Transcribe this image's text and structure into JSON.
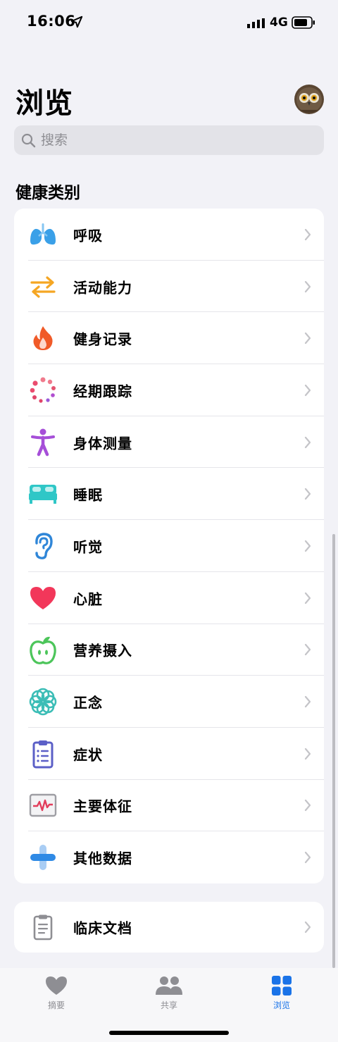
{
  "status_bar": {
    "time": "16:06",
    "network": "4G",
    "icons": [
      "location-arrow-icon",
      "signal-icon",
      "battery-icon"
    ]
  },
  "header": {
    "title": "浏览",
    "search_placeholder": "搜索"
  },
  "section": {
    "title": "健康类别"
  },
  "categories": [
    {
      "label": "呼吸",
      "icon": "lungs-icon",
      "color": "#3aa0e8"
    },
    {
      "label": "活动能力",
      "icon": "arrows-swap-icon",
      "color": "#f5a623"
    },
    {
      "label": "健身记录",
      "icon": "flame-icon",
      "color": "#f05a28"
    },
    {
      "label": "经期跟踪",
      "icon": "cycle-dots-icon",
      "color": "#ea4c6e"
    },
    {
      "label": "身体测量",
      "icon": "figure-icon",
      "color": "#a64fd8"
    },
    {
      "label": "睡眠",
      "icon": "bed-icon",
      "color": "#2fc7c7"
    },
    {
      "label": "听觉",
      "icon": "ear-icon",
      "color": "#2f86d8"
    },
    {
      "label": "心脏",
      "icon": "heart-icon",
      "color": "#f2375a"
    },
    {
      "label": "营养摄入",
      "icon": "apple-icon",
      "color": "#4cc55a"
    },
    {
      "label": "正念",
      "icon": "mindfulness-flower-icon",
      "color": "#3bbdb6"
    },
    {
      "label": "症状",
      "icon": "clipboard-icon",
      "color": "#5b5fc7"
    },
    {
      "label": "主要体征",
      "icon": "vitals-monitor-icon",
      "color": "#e23d5b"
    },
    {
      "label": "其他数据",
      "icon": "plus-cross-icon",
      "color": "#2f8ae5"
    }
  ],
  "clinical": {
    "label": "临床文档",
    "icon": "document-icon"
  },
  "tabs": [
    {
      "label": "摘要",
      "icon": "heart-tab-icon",
      "active": false
    },
    {
      "label": "共享",
      "icon": "people-icon",
      "active": false
    },
    {
      "label": "浏览",
      "icon": "grid-icon",
      "active": true
    }
  ],
  "colors": {
    "accent": "#1a73e8",
    "background": "#f2f2f7"
  }
}
